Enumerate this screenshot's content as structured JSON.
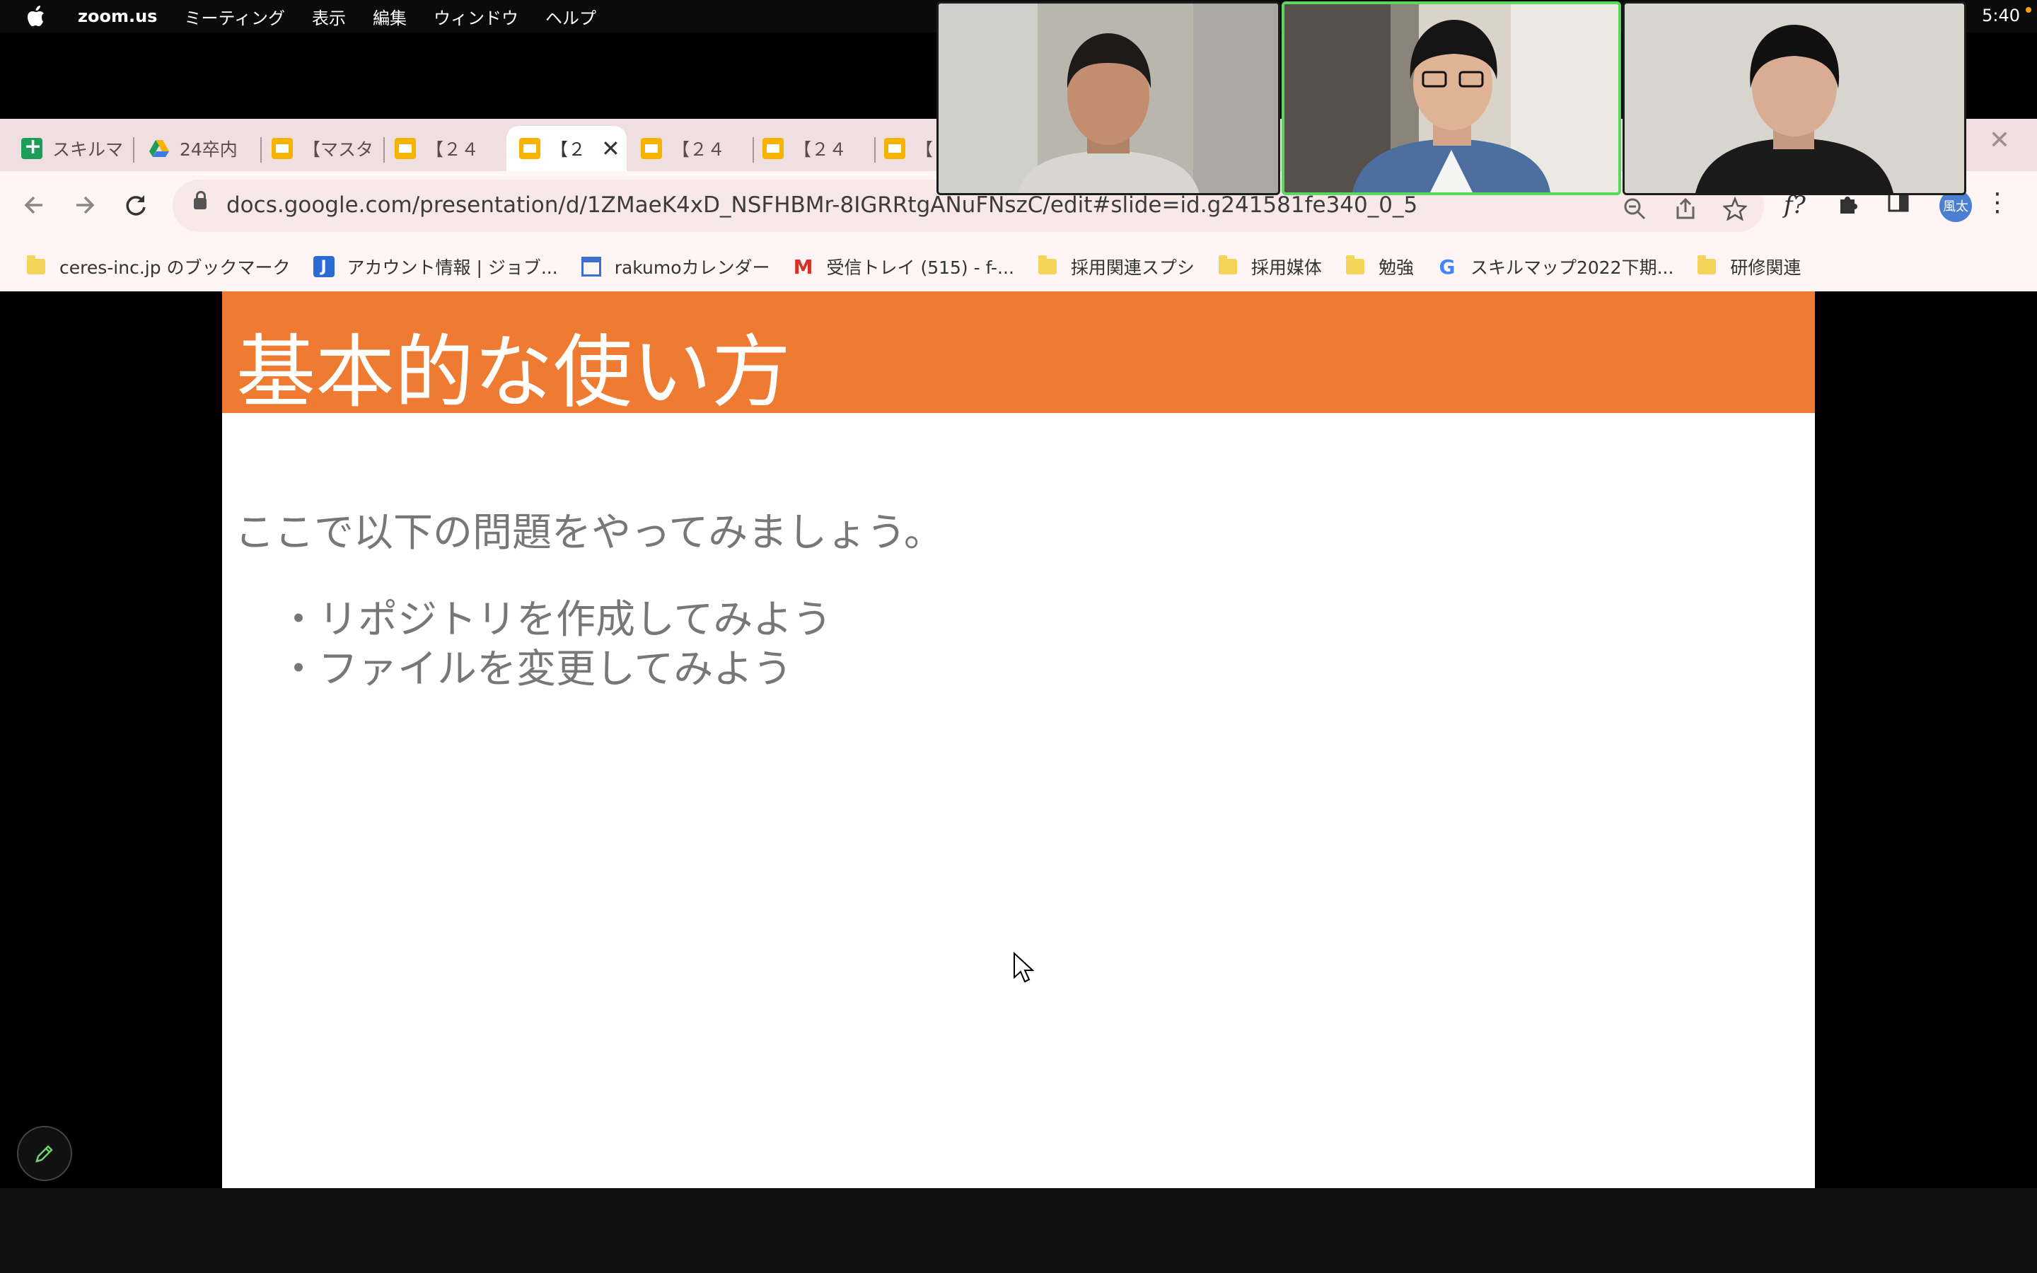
{
  "menubar": {
    "app": "zoom.us",
    "items": [
      "ミーティング",
      "表示",
      "編集",
      "ウィンドウ",
      "ヘルプ"
    ],
    "clock": "5:40"
  },
  "tabs": [
    {
      "label": "スキルマ",
      "icon": "sheets-icon"
    },
    {
      "label": "24卒内",
      "icon": "drive-icon"
    },
    {
      "label": "【マスタ",
      "icon": "slides-icon"
    },
    {
      "label": "【２４",
      "icon": "slides-icon"
    },
    {
      "label": "【２",
      "icon": "slides-icon",
      "active": true
    },
    {
      "label": "【２４",
      "icon": "slides-icon"
    },
    {
      "label": "【２４",
      "icon": "slides-icon"
    },
    {
      "label": "【",
      "icon": "slides-icon"
    }
  ],
  "omnibox": {
    "url": "docs.google.com/presentation/d/1ZMaeK4xD_NSFHBMr-8IGRRtgANuFNszC/edit#slide=id.g241581fe340_0_5"
  },
  "toolbar": {
    "extension_label": "f?",
    "profile_label": "風太"
  },
  "bookmarks": [
    {
      "label": "ceres-inc.jp のブックマーク",
      "icon": "folder-icon"
    },
    {
      "label": "アカウント情報 | ジョブ...",
      "icon": "j-app-icon"
    },
    {
      "label": "rakumoカレンダー",
      "icon": "calendar-icon"
    },
    {
      "label": "受信トレイ (515) - f-...",
      "icon": "gmail-icon"
    },
    {
      "label": "採用関連スプシ",
      "icon": "folder-icon"
    },
    {
      "label": "採用媒体",
      "icon": "folder-icon"
    },
    {
      "label": "勉強",
      "icon": "folder-icon"
    },
    {
      "label": "スキルマップ2022下期...",
      "icon": "google-icon"
    },
    {
      "label": "研修関連",
      "icon": "folder-icon"
    }
  ],
  "slide": {
    "title": "基本的な使い方",
    "intro": "ここで以下の問題をやってみましょう。",
    "bullets": [
      "リポジトリを作成してみよう",
      "ファイルを変更してみよう"
    ]
  },
  "colors": {
    "slide_header": "#ef7b32",
    "tab_strip": "#efdfe0",
    "speaking_border": "#5bd75b"
  }
}
